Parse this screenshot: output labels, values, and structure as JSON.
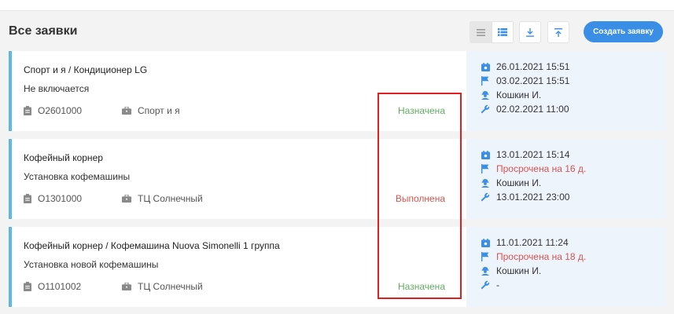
{
  "header": {
    "title": "Все заявки",
    "create_label": "Создать заявку"
  },
  "colors": {
    "accent": "#3b8ee6",
    "card_border": "#5cb8e6",
    "status_assigned": "#5fae5f",
    "status_done": "#d9534f",
    "overdue": "#d9534f",
    "highlight": "#e02020"
  },
  "icons": {
    "view_list": "list-view-icon",
    "view_tiles": "tiles-view-icon",
    "download": "download-icon",
    "upload": "upload-icon",
    "number": "clipboard-icon",
    "client": "briefcase-icon",
    "created": "calendar-icon",
    "deadline": "flag-icon",
    "assignee": "worker-icon",
    "done_date": "wrench-icon"
  },
  "cards": [
    {
      "title": "Спорт и я / Кондиционер LG",
      "desc": "Не включается",
      "number": "О2601000",
      "client": "Спорт и я",
      "status": "Назначена",
      "created": "26.01.2021 15:51",
      "deadline": "03.02.2021 15:51",
      "assignee": "Кошкин И.",
      "done": "02.02.2021 11:00"
    },
    {
      "title": "Кофейный корнер",
      "desc": "Установка кофемашины",
      "number": "О1301000",
      "client": "ТЦ Солнечный",
      "status": "Выполнена",
      "created": "13.01.2021 15:14",
      "deadline": "Просрочена на 16 д.",
      "assignee": "Кошкин И.",
      "done": "13.01.2021 23:00"
    },
    {
      "title": "Кофейный корнер / Кофемашина Nuova Simonelli 1 группа",
      "desc": "Установка новой кофемашины",
      "number": "О1101002",
      "client": "ТЦ Солнечный",
      "status": "Назначена",
      "created": "11.01.2021 11:24",
      "deadline": "Просрочена на 18 д.",
      "assignee": "Кошкин И.",
      "done": "-"
    }
  ]
}
